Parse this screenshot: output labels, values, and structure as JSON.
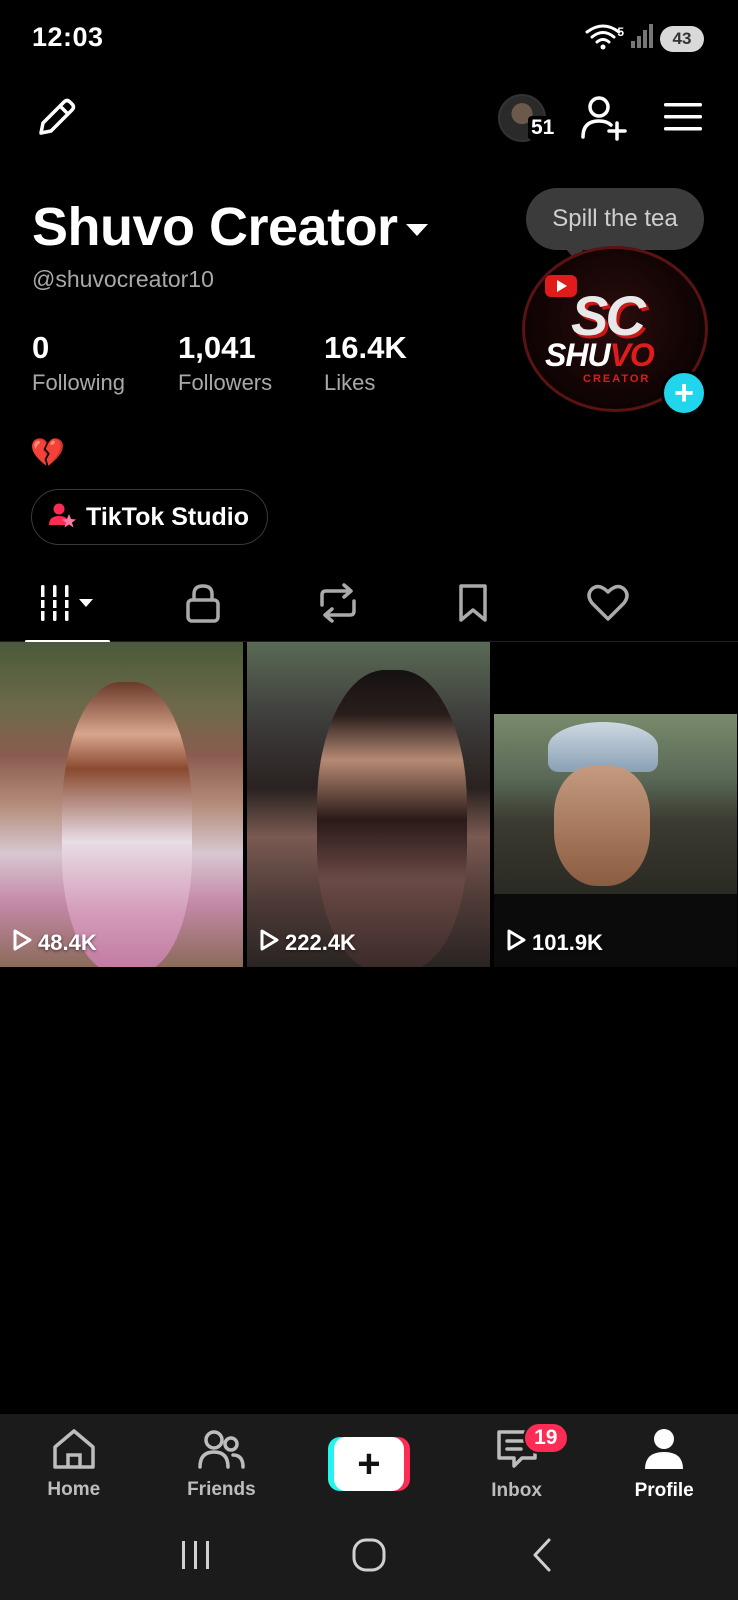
{
  "status_bar": {
    "time": "12:03",
    "wifi_band": "5",
    "battery": "43"
  },
  "top_bar": {
    "edit_icon": "pencil-icon",
    "avatar_badge_count": "51",
    "add_friend_icon": "add-person-icon",
    "menu_icon": "hamburger-menu-icon"
  },
  "profile": {
    "display_name": "Shuvo Creator",
    "username": "@shuvocreator10",
    "stats": [
      {
        "value": "0",
        "label": "Following"
      },
      {
        "value": "1,041",
        "label": "Followers"
      },
      {
        "value": "16.4K",
        "label": "Likes"
      }
    ],
    "bio": "💔",
    "studio_button": "TikTok Studio",
    "bubble_text": "Spill the tea",
    "avatar_logo": {
      "big": "SC",
      "name_a": "SHU",
      "name_b": "VO",
      "sub": "CREATOR"
    }
  },
  "tabs": [
    {
      "name": "videos",
      "icon": "grid-icon",
      "active": true
    },
    {
      "name": "private",
      "icon": "lock-icon",
      "active": false
    },
    {
      "name": "reposts",
      "icon": "repost-icon",
      "active": false
    },
    {
      "name": "favorites",
      "icon": "bookmark-icon",
      "active": false
    },
    {
      "name": "liked",
      "icon": "heart-icon",
      "active": false
    }
  ],
  "videos": [
    {
      "views": "48.4K"
    },
    {
      "views": "222.4K"
    },
    {
      "views": "101.9K"
    }
  ],
  "bottom_nav": {
    "items": [
      {
        "label": "Home",
        "icon": "home-icon"
      },
      {
        "label": "Friends",
        "icon": "friends-icon"
      },
      {
        "label": "",
        "icon": "plus-icon"
      },
      {
        "label": "Inbox",
        "icon": "inbox-icon",
        "badge": "19"
      },
      {
        "label": "Profile",
        "icon": "profile-icon",
        "active": true
      }
    ]
  },
  "colors": {
    "accent_cyan": "#20d5ec",
    "accent_red": "#fe2c55",
    "background": "#000000",
    "nav_background": "#1b1b1b"
  }
}
